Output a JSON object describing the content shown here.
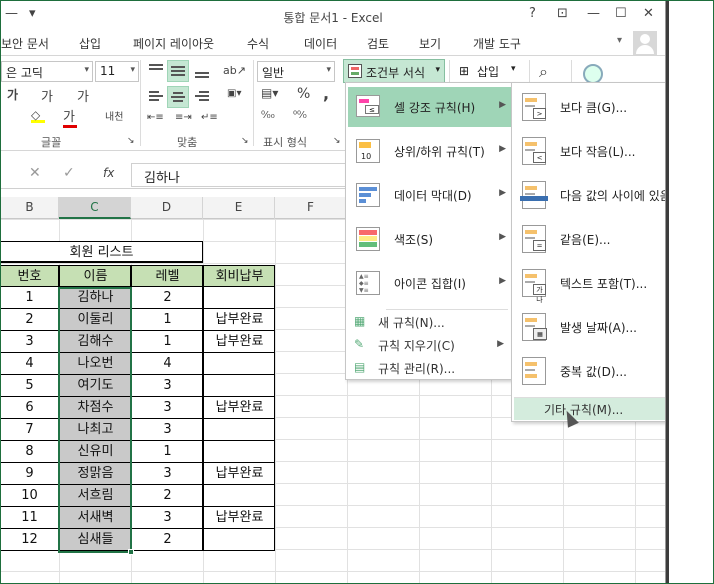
{
  "window": {
    "title": "통합 문서1 - Excel",
    "qat": "▾",
    "help": "?",
    "restore_ribbon": "⊡",
    "minimize": "—",
    "maximize": "☐",
    "close": "✕"
  },
  "tabs": [
    "보안 문서",
    "삽입",
    "페이지 레이아웃",
    "수식",
    "데이터",
    "검토",
    "보기",
    "개발 도구"
  ],
  "ribbon": {
    "font_name": "은 고딕",
    "font_size": "11",
    "num_format": "일반",
    "bold_glyph": "가",
    "grow_glyph": "가",
    "shrink_glyph": "가",
    "percent": "%",
    "comma": ",",
    "wrap": "내천",
    "cond_format": "조건부 서식",
    "insert": "삽입",
    "group_font": "글꼴",
    "group_align": "맞춤",
    "group_number": "표시 형식"
  },
  "formula_bar": {
    "value": "김하나",
    "fx": "fx"
  },
  "columns": [
    "B",
    "C",
    "D",
    "E",
    "F"
  ],
  "sheet": {
    "title": "회원 리스트",
    "headers": [
      "번호",
      "이름",
      "레벨",
      "회비납부"
    ],
    "rows": [
      [
        "1",
        "김하나",
        "2",
        ""
      ],
      [
        "2",
        "이둘리",
        "1",
        "납부완료"
      ],
      [
        "3",
        "김해수",
        "1",
        "납부완료"
      ],
      [
        "4",
        "나오번",
        "4",
        ""
      ],
      [
        "5",
        "여기도",
        "3",
        ""
      ],
      [
        "6",
        "차점수",
        "3",
        "납부완료"
      ],
      [
        "7",
        "나최고",
        "3",
        ""
      ],
      [
        "8",
        "신유미",
        "1",
        ""
      ],
      [
        "9",
        "정맑음",
        "3",
        "납부완료"
      ],
      [
        "10",
        "서흐림",
        "2",
        ""
      ],
      [
        "11",
        "서새벽",
        "3",
        "납부완료"
      ],
      [
        "12",
        "심새들",
        "2",
        ""
      ]
    ]
  },
  "cf_menu": {
    "items": [
      "셀 강조 규칙(H)",
      "상위/하위 규칙(T)",
      "데이터 막대(D)",
      "색조(S)",
      "아이콘 집합(I)"
    ],
    "small_items": [
      "새 규칙(N)...",
      "규칙 지우기(C)",
      "규칙 관리(R)..."
    ]
  },
  "sub_menu": {
    "items": [
      "보다 큼(G)...",
      "보다 작음(L)...",
      "다음 값의 사이에 있음(B)...",
      "같음(E)...",
      "텍스트 포함(T)...",
      "발생 날짜(A)...",
      "중복 값(D)..."
    ],
    "more": "기타 규칙(M)..."
  },
  "colors": {
    "accent": "#217346",
    "highlight": "#9fd5b7",
    "header_fill": "#c6e0b4",
    "name_fill": "#c9c9c9"
  }
}
